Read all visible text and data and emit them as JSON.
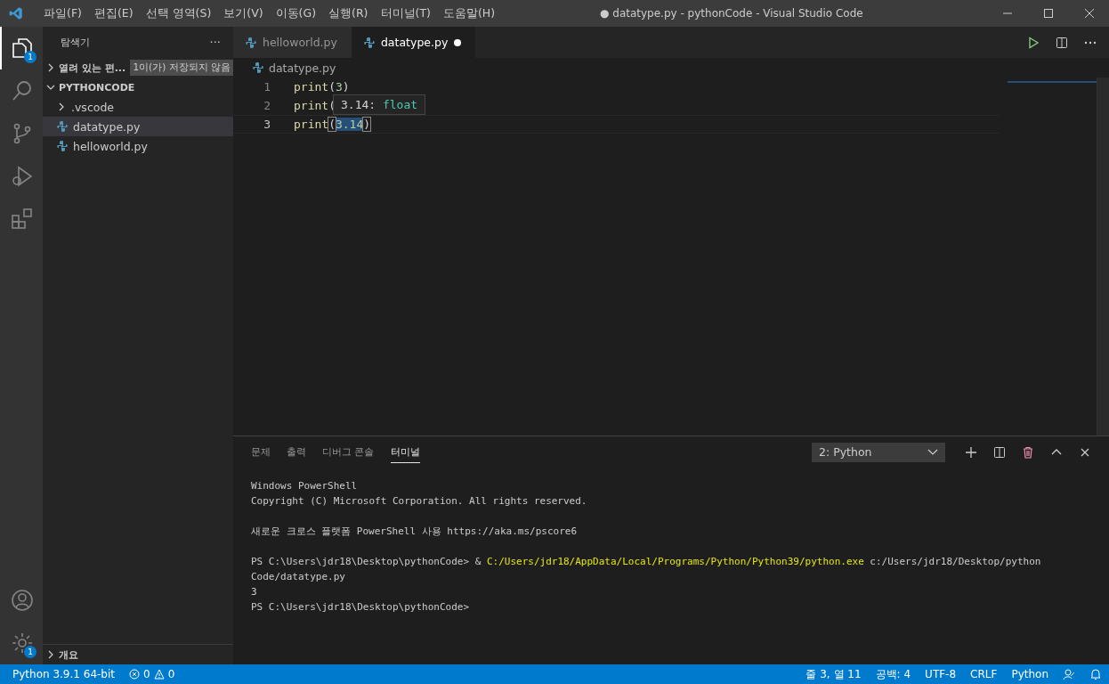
{
  "window": {
    "title": "● datatype.py - pythonCode - Visual Studio Code"
  },
  "menu": [
    "파일(F)",
    "편집(E)",
    "선택 영역(S)",
    "보기(V)",
    "이동(G)",
    "실행(R)",
    "터미널(T)",
    "도움말(H)"
  ],
  "activity_bar": [
    {
      "kind": "files",
      "selected": true,
      "badge": "1"
    },
    {
      "kind": "search",
      "selected": false
    },
    {
      "kind": "scm",
      "selected": false
    },
    {
      "kind": "debug",
      "selected": false
    },
    {
      "kind": "extensions",
      "selected": false
    }
  ],
  "activity_bottom": [
    {
      "kind": "account"
    },
    {
      "kind": "settings",
      "badge": "1"
    }
  ],
  "sidebar": {
    "title": "탐색기",
    "more": "···",
    "open_editors": {
      "label": "열려 있는 편...",
      "badge": "1이(가) 저장되지 않음",
      "expanded": false
    },
    "folder": {
      "label": "PYTHONCODE",
      "expanded": true,
      "items": [
        {
          "kind": "folder",
          "label": ".vscode",
          "selected": false
        },
        {
          "kind": "python",
          "label": "datatype.py",
          "selected": true
        },
        {
          "kind": "python",
          "label": "helloworld.py",
          "selected": false
        }
      ]
    },
    "outline": {
      "label": "개요",
      "expanded": false
    }
  },
  "tabs": [
    {
      "label": "helloworld.py",
      "selected": false,
      "dirty": false
    },
    {
      "label": "datatype.py",
      "selected": true,
      "dirty": true
    }
  ],
  "breadcrumb": "datatype.py",
  "code": [
    {
      "number": "1",
      "current": false,
      "tokens": [
        {
          "kind": "fn",
          "text": "print"
        },
        {
          "kind": "punct",
          "text": "("
        },
        {
          "kind": "num",
          "text": "3"
        },
        {
          "kind": "punct",
          "text": ")"
        }
      ]
    },
    {
      "number": "2",
      "current": false,
      "tokens": [
        {
          "kind": "fn",
          "text": "print"
        },
        {
          "kind": "punct",
          "text": "("
        }
      ]
    },
    {
      "number": "3",
      "current": true,
      "tokens": [
        {
          "kind": "fn",
          "text": "print"
        },
        {
          "kind": "bracket",
          "text": "("
        },
        {
          "kind": "selected",
          "text": "3.14"
        },
        {
          "kind": "bracket",
          "text": ")"
        }
      ]
    }
  ],
  "hover": {
    "value": "3.14:",
    "type": "float"
  },
  "panel": {
    "tabs": [
      {
        "label": "문제",
        "selected": false
      },
      {
        "label": "출력",
        "selected": false
      },
      {
        "label": "디버그 콘솔",
        "selected": false
      },
      {
        "label": "터미널",
        "selected": true
      }
    ],
    "terminal_select": "2: Python",
    "terminal": [
      [
        [
          {
            "kind": "plain",
            "text": "Windows PowerShell"
          }
        ],
        [
          {
            "kind": "plain",
            "text": "Copyright (C) Microsoft Corporation. All rights reserved."
          }
        ]
      ],
      [
        [
          {
            "kind": "plain",
            "text": "새로운 크로스 플랫폼 PowerShell 사용 https://aka.ms/pscore6"
          }
        ]
      ],
      [
        [
          {
            "kind": "plain",
            "text": "PS C:\\Users\\jdr18\\Desktop\\pythonCode> & "
          },
          {
            "kind": "path",
            "text": "C:/Users/jdr18/AppData/Local/Programs/Python/Python39/python.exe"
          },
          {
            "kind": "plain",
            "text": " c:/Users/jdr18/Desktop/python"
          }
        ],
        [
          {
            "kind": "plain",
            "text": "Code/datatype.py"
          }
        ],
        [
          {
            "kind": "plain",
            "text": "3"
          }
        ],
        [
          {
            "kind": "plain",
            "text": "PS C:\\Users\\jdr18\\Desktop\\pythonCode>"
          }
        ]
      ]
    ]
  },
  "status_bar": {
    "interpreter": "Python 3.9.1 64-bit",
    "errors": "0",
    "warnings": "0",
    "right": [
      "줄 3, 열 11",
      "공백: 4",
      "UTF-8",
      "CRLF",
      "Python"
    ]
  }
}
